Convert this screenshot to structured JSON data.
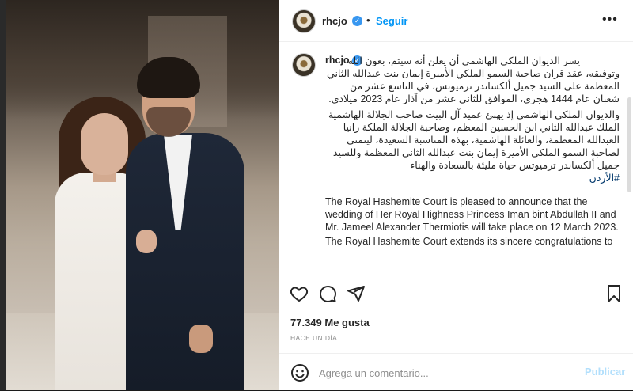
{
  "account": {
    "username": "rhcjo",
    "follow_label": "Seguir",
    "separator": "•",
    "more_label": "•••"
  },
  "caption": {
    "arabic_p1": "يسر الديوان الملكي الهاشمي أن يعلن أنه سيتم، بعون الله وتوفيقه، عقد قران صاحبة السمو الملكي الأميرة إيمان بنت عبدالله الثاني المعظمة على السيد جميل ألكساندر ترميوتس، في التاسع عشر من شعبان عام 1444 هجري، الموافق للثاني عشر من آذار عام 2023 ميلادي.",
    "arabic_p2": "والديوان الملكي الهاشمي إذ يهنئ عميد آل البيت صاحب الجلالة الهاشمية الملك عبدالله الثاني ابن الحسين المعظم، وصاحبة الجلالة الملكة رانيا العبدالله المعظمة، والعائلة الهاشمية، بهذه المناسبة السعيدة، ليتمنى لصاحبة السمو الملكي الأميرة إيمان بنت عبدالله الثاني المعظمة وللسيد جميل ألكساندر ترميوتس حياة مليئة بالسعادة والهناء",
    "hashtag": "#الأردن",
    "english_p1": "The Royal Hashemite Court is pleased to announce that the wedding of Her Royal Highness Princess Iman bint Abdullah II and Mr. Jameel Alexander Thermiotis will take place on 12 March 2023.",
    "english_p2": "The Royal Hashemite Court extends its sincere congratulations to"
  },
  "stats": {
    "likes": "77.349 Me gusta",
    "time": "HACE UN DÍA"
  },
  "comment": {
    "placeholder": "Agrega un comentario...",
    "publish_label": "Publicar"
  }
}
